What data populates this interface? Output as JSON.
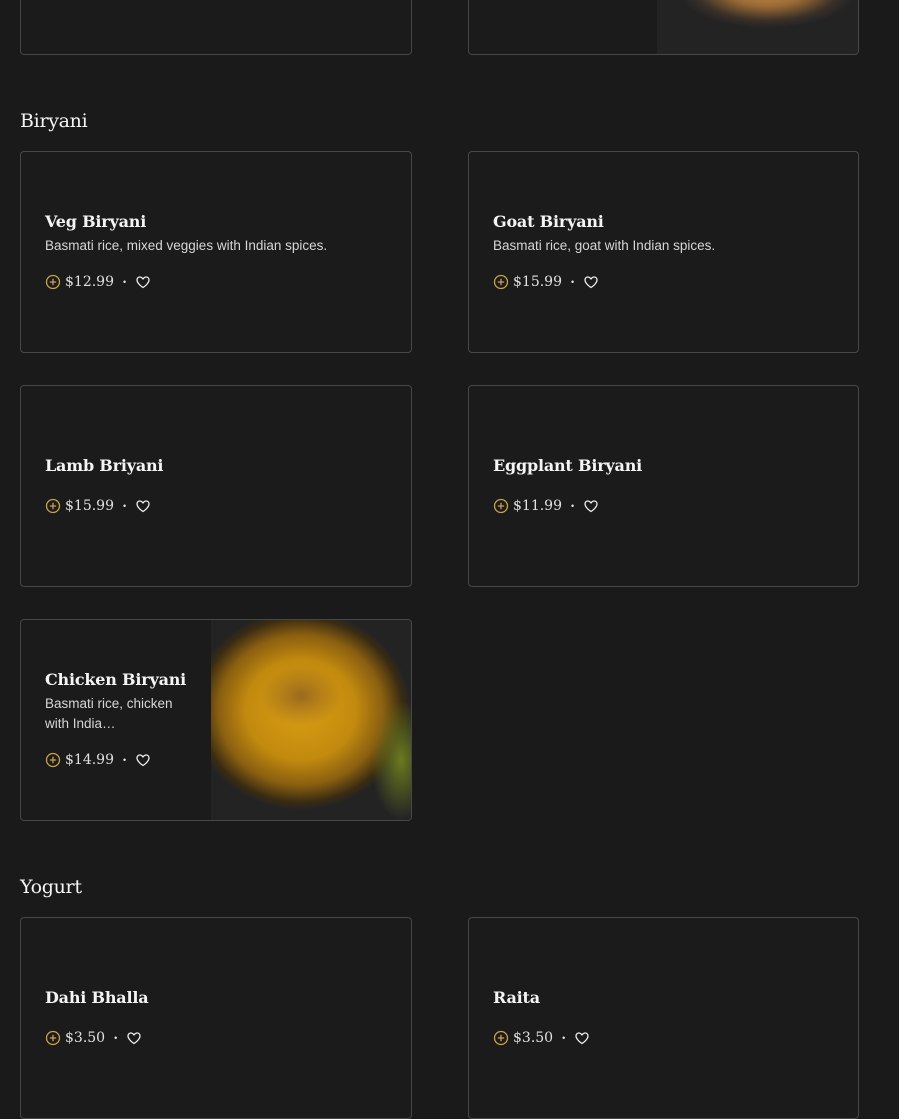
{
  "sections": {
    "biryani": {
      "title": "Biryani",
      "items": [
        {
          "name": "Veg Biryani",
          "description": "Basmati rice, mixed veggies with Indian spices.",
          "price": "$12.99"
        },
        {
          "name": "Goat Biryani",
          "description": "Basmati rice, goat with Indian spices.",
          "price": "$15.99"
        },
        {
          "name": "Lamb Briyani",
          "description": "",
          "price": "$15.99"
        },
        {
          "name": "Eggplant Biryani",
          "description": "",
          "price": "$11.99"
        },
        {
          "name": "Chicken Biryani",
          "description": "Basmati rice, chicken with India…",
          "price": "$14.99"
        }
      ]
    },
    "yogurt": {
      "title": "Yogurt",
      "items": [
        {
          "name": "Dahi Bhalla",
          "description": "",
          "price": "$3.50"
        },
        {
          "name": "Raita",
          "description": "",
          "price": "$3.50"
        }
      ]
    }
  },
  "separator": "•",
  "icons": {
    "add": "add-circle-icon",
    "favorite": "heart-outline-icon"
  },
  "colors": {
    "background": "#1a1a1b",
    "card_border": "#474747",
    "add_icon": "#c9a24a",
    "text": "#f4f4f4"
  }
}
